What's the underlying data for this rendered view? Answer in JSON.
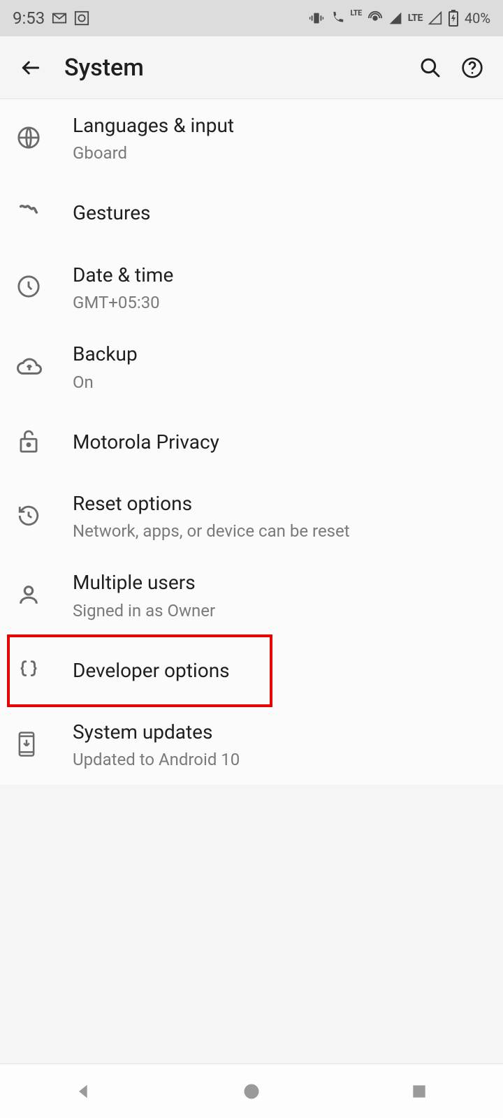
{
  "status": {
    "time": "9:53",
    "battery": "40%",
    "lte": "LTE"
  },
  "header": {
    "title": "System"
  },
  "items": [
    {
      "title": "Languages & input",
      "sub": "Gboard"
    },
    {
      "title": "Gestures",
      "sub": ""
    },
    {
      "title": "Date & time",
      "sub": "GMT+05:30"
    },
    {
      "title": "Backup",
      "sub": "On"
    },
    {
      "title": "Motorola Privacy",
      "sub": ""
    },
    {
      "title": "Reset options",
      "sub": "Network, apps, or device can be reset"
    },
    {
      "title": "Multiple users",
      "sub": "Signed in as Owner"
    },
    {
      "title": "Developer options",
      "sub": ""
    },
    {
      "title": "System updates",
      "sub": "Updated to Android 10"
    }
  ],
  "highlight_index": 7
}
